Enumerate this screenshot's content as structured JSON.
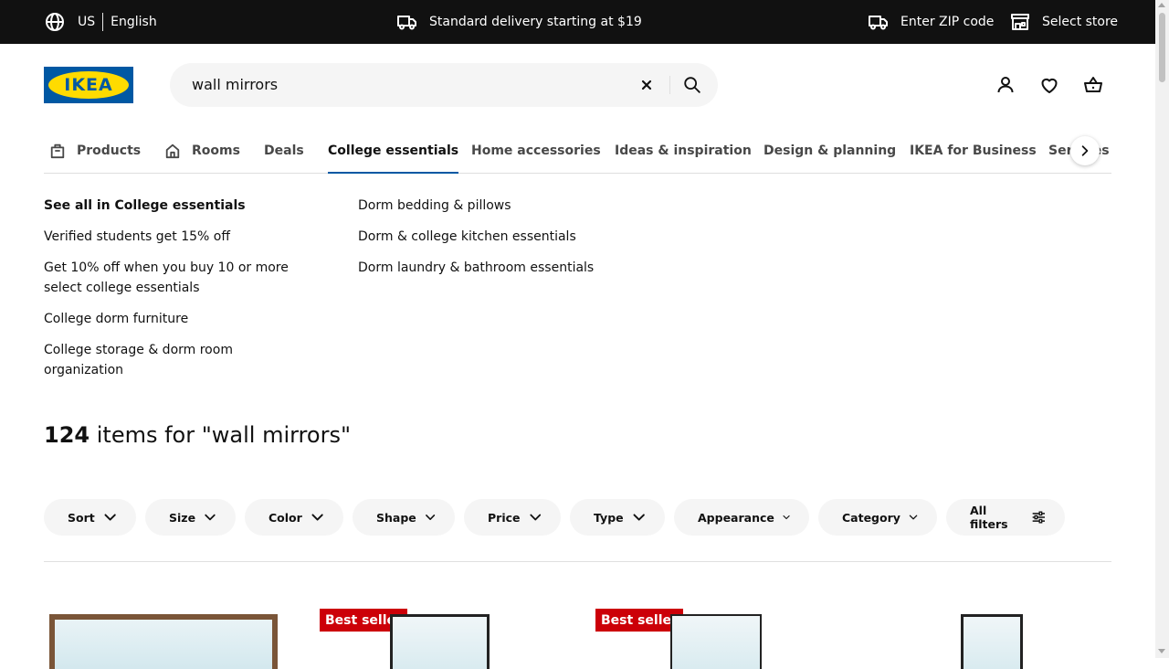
{
  "topbar": {
    "country": "US",
    "language": "English",
    "delivery": "Standard delivery starting at $19",
    "zip": "Enter ZIP code",
    "store": "Select store"
  },
  "header": {
    "logo_text": "IKEA",
    "search_value": "wall mirrors"
  },
  "nav": {
    "items": [
      {
        "label": "Products"
      },
      {
        "label": "Rooms"
      },
      {
        "label": "Deals"
      },
      {
        "label": "College essentials"
      },
      {
        "label": "Home accessories"
      },
      {
        "label": "Ideas & inspiration"
      },
      {
        "label": "Design & planning"
      },
      {
        "label": "IKEA for Business"
      },
      {
        "label": "Services &"
      }
    ],
    "active": "College essentials"
  },
  "panel": {
    "col1": [
      "See all in College essentials",
      "Verified students get 15% off",
      "Get 10% off when you buy 10 or more select college essentials",
      "College dorm furniture",
      "College storage & dorm room organization"
    ],
    "col2": [
      "Dorm bedding & pillows",
      "Dorm & college kitchen essentials",
      "Dorm laundry & bathroom essentials"
    ]
  },
  "results": {
    "count": "124",
    "text": " items for \"wall mirrors\""
  },
  "filters": [
    "Sort",
    "Size",
    "Color",
    "Shape",
    "Price",
    "Type",
    "Appearance",
    "Category",
    "All filters"
  ],
  "products": {
    "badge": "Best seller"
  },
  "colors": {
    "brand_blue": "#0058a3",
    "brand_yellow": "#ffdb00",
    "badge_red": "#cc0008"
  }
}
